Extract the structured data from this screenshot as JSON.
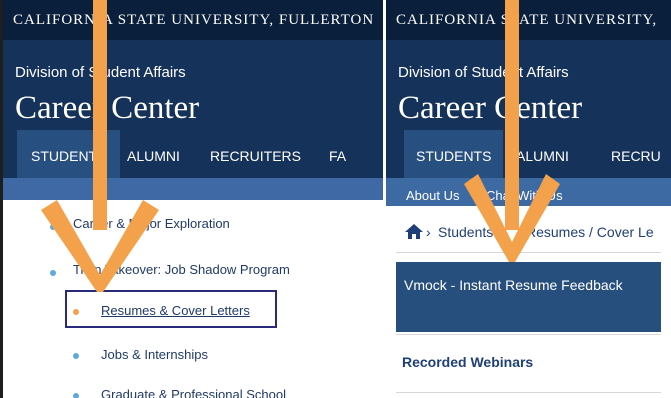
{
  "left": {
    "university": "CALIFORNIA STATE UNIVERSITY, FULLERTON",
    "division": "Division of Student Affairs",
    "title": "Career Center",
    "nav": [
      "STUDENTS",
      "ALUMNI",
      "RECRUITERS",
      "FA"
    ],
    "sidebar": [
      "Career & Major Exploration",
      "Titan Takeover: Job Shadow Program",
      "Resumes & Cover Letters",
      "Jobs & Internships",
      "Graduate & Professional School"
    ]
  },
  "right": {
    "university": "CALIFORNIA STATE UNIVERSITY,",
    "division": "Division of Student Affairs",
    "title": "Career Center",
    "nav": [
      "STUDENTS",
      "ALUMNI",
      "RECRU"
    ],
    "subnav": [
      "About Us",
      "Chat With Us"
    ],
    "breadcrumb": [
      "Students",
      "Resumes / Cover Le"
    ],
    "sidebar": [
      "Vmock - Instant Resume Feedback",
      "Recorded Webinars"
    ]
  },
  "colors": {
    "top_bar": "#0a1f3c",
    "header": "#15325a",
    "active_nav": "#274f80",
    "subnav": "#3d6aa2",
    "arrow": "#f3a14a",
    "highlight_box": "#2a2a7a"
  }
}
